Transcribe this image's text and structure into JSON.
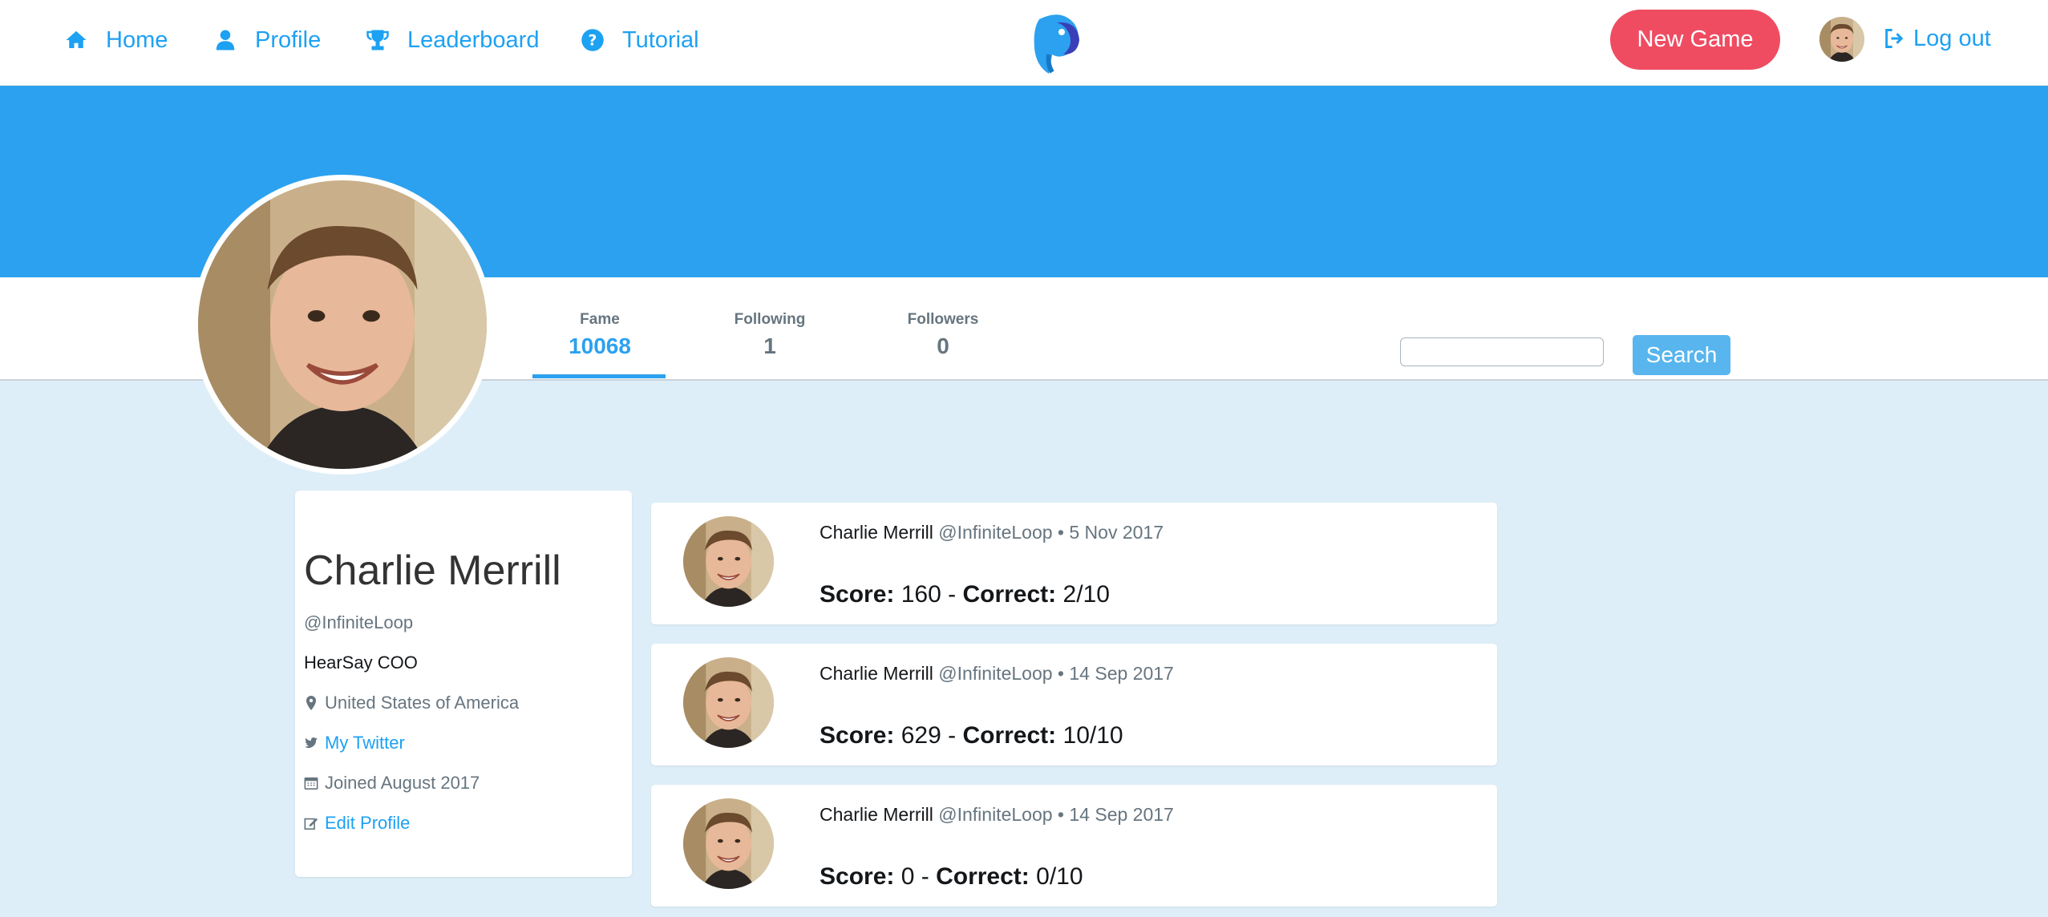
{
  "nav": {
    "home": "Home",
    "profile": "Profile",
    "leaderboard": "Leaderboard",
    "tutorial": "Tutorial",
    "new_game": "New Game",
    "logout": "Log out"
  },
  "stats": {
    "fame_label": "Fame",
    "fame_value": "10068",
    "following_label": "Following",
    "following_value": "1",
    "followers_label": "Followers",
    "followers_value": "0"
  },
  "search": {
    "button": "Search",
    "value": ""
  },
  "profile": {
    "name": "Charlie Merrill",
    "handle": "@InfiniteLoop",
    "bio": "HearSay COO",
    "location": "United States of America",
    "twitter_link": "My Twitter",
    "joined": "Joined August 2017",
    "edit_link": "Edit Profile"
  },
  "games": [
    {
      "name": "Charlie Merrill",
      "handle": "@InfiniteLoop",
      "sep": "•",
      "date": "5 Nov 2017",
      "score_label": "Score:",
      "score": "160",
      "dash": "-",
      "correct_label": "Correct:",
      "correct": "2/10"
    },
    {
      "name": "Charlie Merrill",
      "handle": "@InfiniteLoop",
      "sep": "•",
      "date": "14 Sep 2017",
      "score_label": "Score:",
      "score": "629",
      "dash": "-",
      "correct_label": "Correct:",
      "correct": "10/10"
    },
    {
      "name": "Charlie Merrill",
      "handle": "@InfiniteLoop",
      "sep": "•",
      "date": "14 Sep 2017",
      "score_label": "Score:",
      "score": "0",
      "dash": "-",
      "correct_label": "Correct:",
      "correct": "0/10"
    }
  ],
  "colors": {
    "accent": "#1da1f2",
    "banner": "#2ca1ef",
    "page_bg": "#ddeef8",
    "new_game": "#ef4c62"
  },
  "icons": [
    "home-icon",
    "user-icon",
    "trophy-icon",
    "question-circle-icon",
    "logout-icon",
    "map-marker-icon",
    "twitter-icon",
    "calendar-icon",
    "edit-icon"
  ]
}
